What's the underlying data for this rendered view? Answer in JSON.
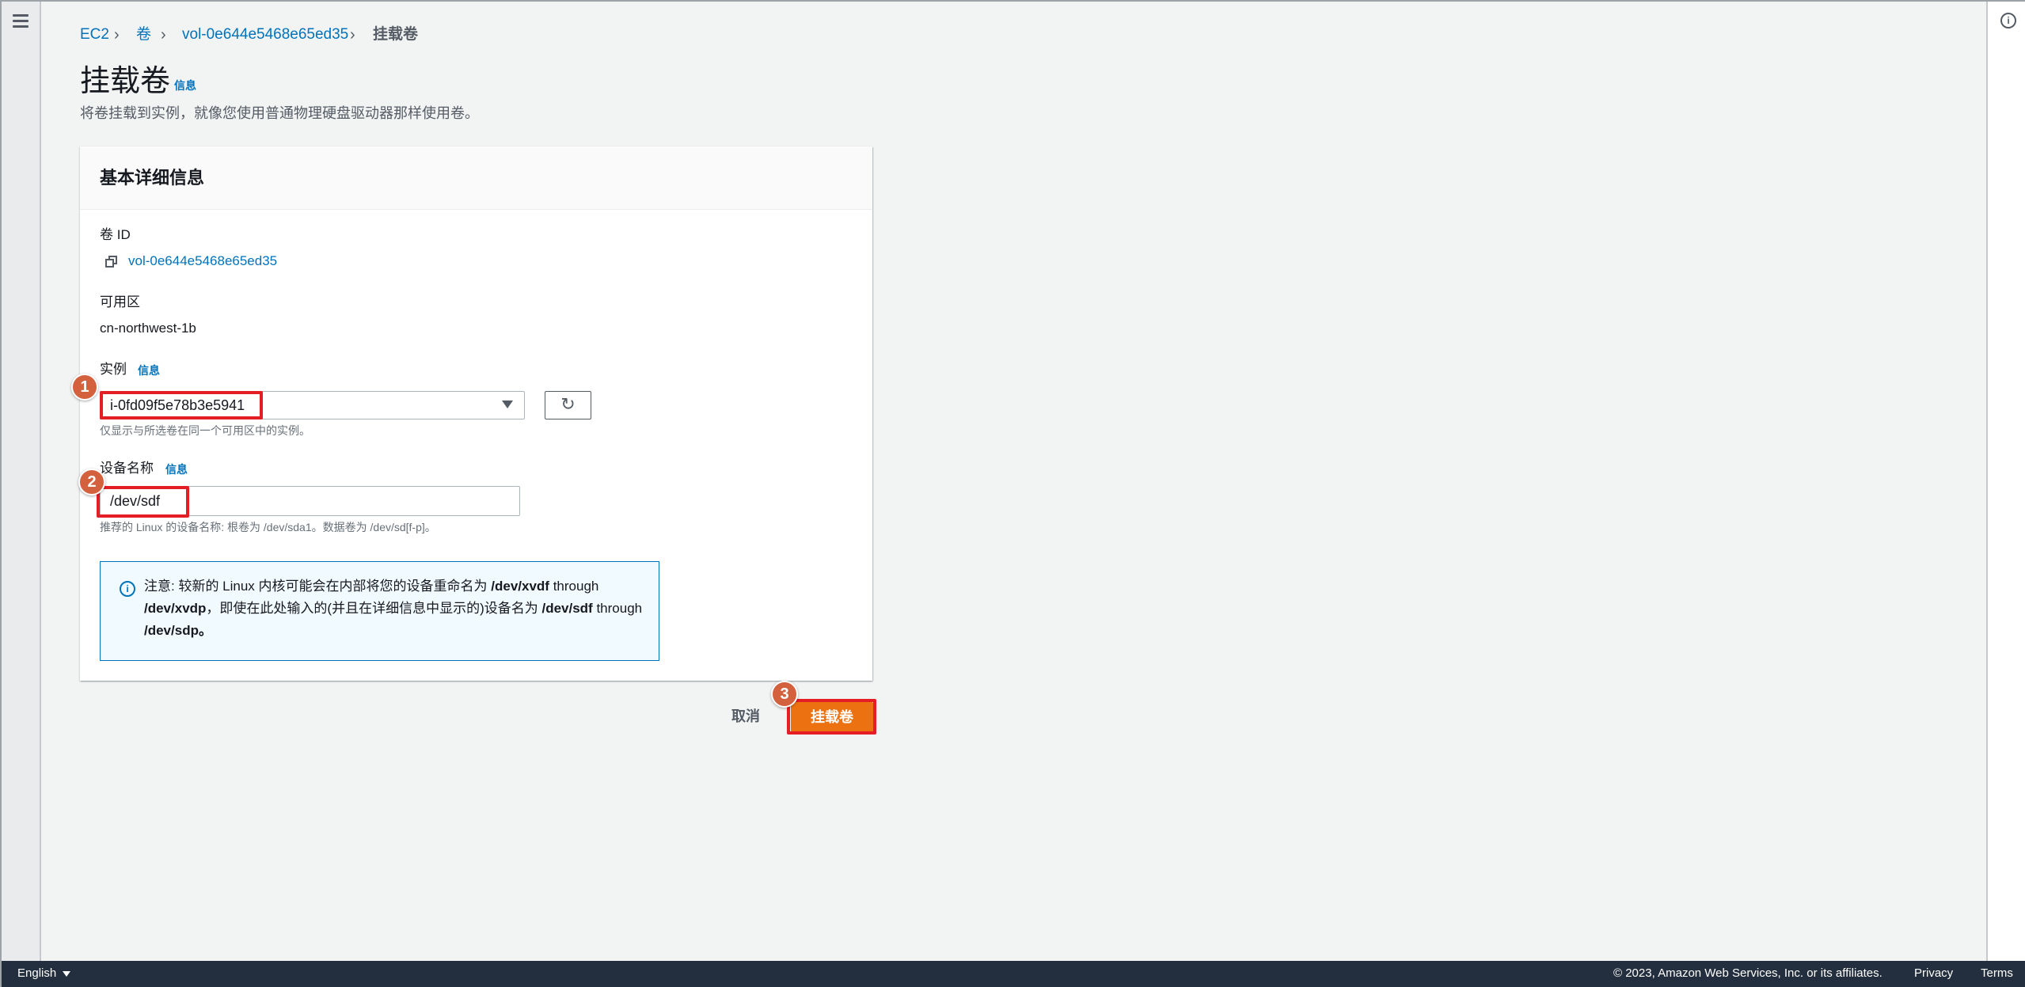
{
  "breadcrumb": {
    "items": [
      "EC2",
      "卷",
      "vol-0e644e5468e65ed35"
    ],
    "current": "挂载卷",
    "separator": "›"
  },
  "header": {
    "title": "挂载卷",
    "info_link": "信息",
    "description": "将卷挂载到实例，就像您使用普通物理硬盘驱动器那样使用卷。"
  },
  "card": {
    "title": "基本详细信息",
    "volume_id_label": "卷 ID",
    "volume_id": "vol-0e644e5468e65ed35",
    "az_label": "可用区",
    "az_value": "cn-northwest-1b",
    "instance_label": "实例",
    "instance_info": "信息",
    "instance_value": "i-0fd09f5e78b3e5941",
    "instance_hint": "仅显示与所选卷在同一个可用区中的实例。",
    "refresh_icon": "↻",
    "device_label": "设备名称",
    "device_info": "信息",
    "device_value": "/dev/sdf",
    "device_hint": "推荐的 Linux 的设备名称: 根卷为 /dev/sda1。数据卷为 /dev/sd[f-p]。",
    "callout": {
      "icon": "i",
      "part1": "注意: 较新的 Linux 内核可能会在内部将您的设备重命名为 ",
      "bold1": "/dev/xvdf",
      "part2": " through ",
      "bold2": "/dev/xvdp",
      "part3": "，即使在此处输入的(并且在详细信息中显示的)设备名为 ",
      "bold3": "/dev/sdf",
      "part4": " through ",
      "bold4": "/dev/sdp。"
    }
  },
  "actions": {
    "cancel": "取消",
    "attach": "挂载卷"
  },
  "annotations": {
    "badges": [
      "1",
      "2",
      "3"
    ],
    "highlight_color": "#e51d25",
    "badge_color": "#d4613e"
  },
  "footer": {
    "language": "English",
    "copyright": "© 2023, Amazon Web Services, Inc. or its affiliates.",
    "privacy": "Privacy",
    "terms": "Terms"
  },
  "colors": {
    "accent": "#ec7211",
    "link": "#0073bb",
    "footer_bg": "#232f3e",
    "page_bg": "#f2f3f3"
  }
}
